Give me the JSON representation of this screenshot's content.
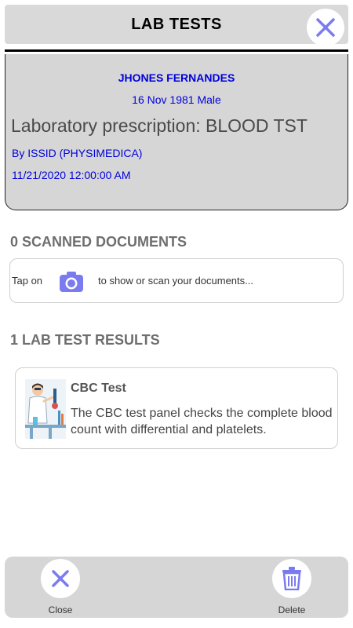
{
  "header": {
    "title": "LAB TESTS",
    "close_icon": "close-icon"
  },
  "patient": {
    "name": "JHONES FERNANDES",
    "birth_and_gender": "16 Nov 1981  Male",
    "prescription": "Laboratory prescription: BLOOD TST",
    "doctor": "By ISSID (PHYSIMEDICA)",
    "datetime": "11/21/2020 12:00:00 AM"
  },
  "scanned": {
    "title": "0 SCANNED DOCUMENTS",
    "tap_label": "Tap on",
    "hint": "to show or scan your documents...",
    "icon": "camera-icon"
  },
  "results": {
    "title": "1 LAB TEST RESULTS",
    "items": [
      {
        "name": "CBC Test",
        "description": "The CBC test panel checks the complete blood count with differential and platelets.",
        "icon": "scientist-illustration"
      }
    ]
  },
  "footer": {
    "close_label": "Close",
    "delete_label": "Delete"
  },
  "colors": {
    "accent": "#7b7bf0",
    "patient_text": "#0000dd",
    "panel_bg": "#d6d6d6"
  }
}
